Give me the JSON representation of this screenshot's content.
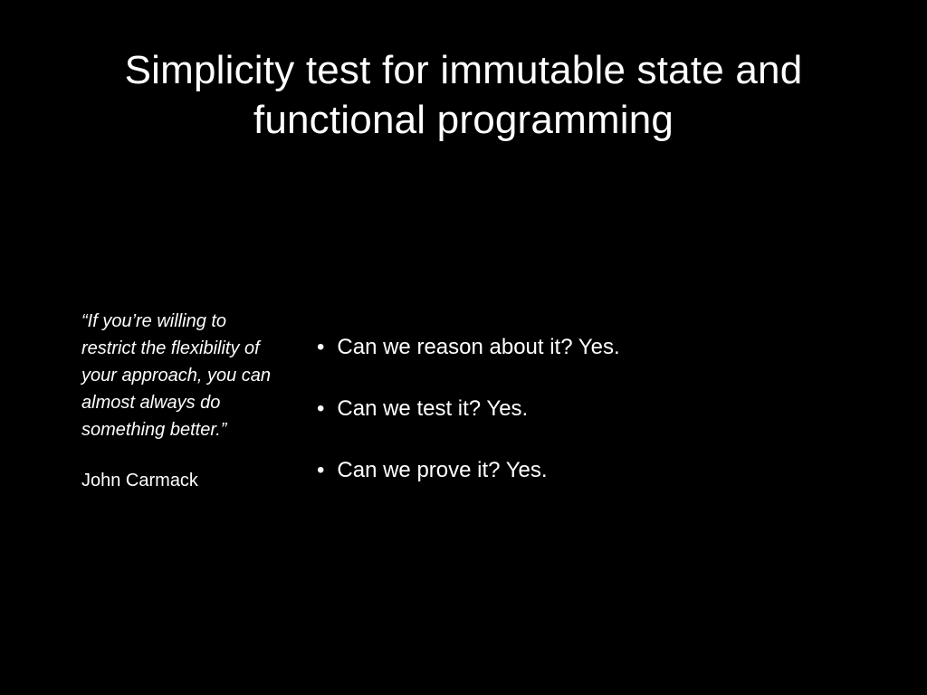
{
  "title": "Simplicity test for immutable state and functional programming",
  "quote": {
    "text": "“If you’re willing to restrict the flexibility of your approach, you can almost always do something better.”",
    "attribution": "John Carmack"
  },
  "bullets": [
    "Can we reason about it? Yes.",
    "Can we test it? Yes.",
    "Can we prove it? Yes."
  ]
}
